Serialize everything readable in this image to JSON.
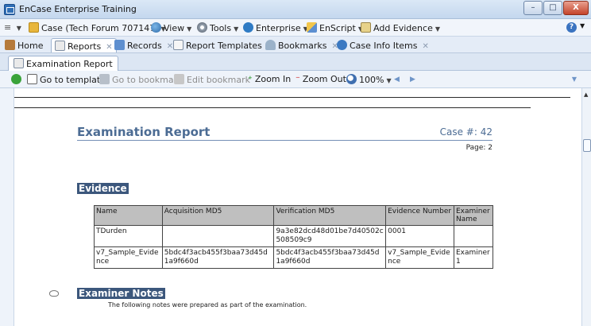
{
  "window": {
    "title": "EnCase Enterprise Training",
    "controls": {
      "minimize": "–",
      "maximize": "□",
      "close": "X"
    }
  },
  "menubar": {
    "items": [
      {
        "label": "Case (Tech Forum 707147)",
        "icon": "folder-icon"
      },
      {
        "label": "View",
        "icon": "view-icon"
      },
      {
        "label": "Tools",
        "icon": "tools-icon"
      },
      {
        "label": "Enterprise",
        "icon": "enterprise-icon"
      },
      {
        "label": "EnScript",
        "icon": "enscript-icon"
      },
      {
        "label": "Add Evidence",
        "icon": "add-evidence-icon"
      }
    ],
    "help": "?"
  },
  "tabs": [
    {
      "label": "Home"
    },
    {
      "label": "Reports"
    },
    {
      "label": "Records"
    },
    {
      "label": "Report Templates"
    },
    {
      "label": "Bookmarks"
    },
    {
      "label": "Case Info Items"
    }
  ],
  "subtab": {
    "label": "Examination Report"
  },
  "toolbar": {
    "go_to_template": "Go to template",
    "go_to_bookmark": "Go to bookmark",
    "edit_bookmark": "Edit bookmark",
    "zoom_in": "Zoom In",
    "zoom_out": "Zoom Out",
    "zoom_level": "100%"
  },
  "report": {
    "title": "Examination Report",
    "case_number": "Case #: 42",
    "page": "Page: 2",
    "evidence_heading": "Evidence",
    "evidence_table": {
      "columns": [
        "Name",
        "Acquisition MD5",
        "Verification MD5",
        "Evidence Number",
        "Examiner Name"
      ],
      "rows": [
        [
          "TDurden",
          "",
          "9a3e82dcd48d01be7d40502c508509c9",
          "0001",
          ""
        ],
        [
          "v7_Sample_Evidence",
          "5bdc4f3acb455f3baa73d45d1a9f660d",
          "5bdc4f3acb455f3baa73d45d1a9f660d",
          "v7_Sample_Evidence",
          "Examiner 1"
        ]
      ]
    },
    "notes_heading": "Examiner Notes",
    "notes_text": "The following notes were prepared as part of the examination."
  }
}
